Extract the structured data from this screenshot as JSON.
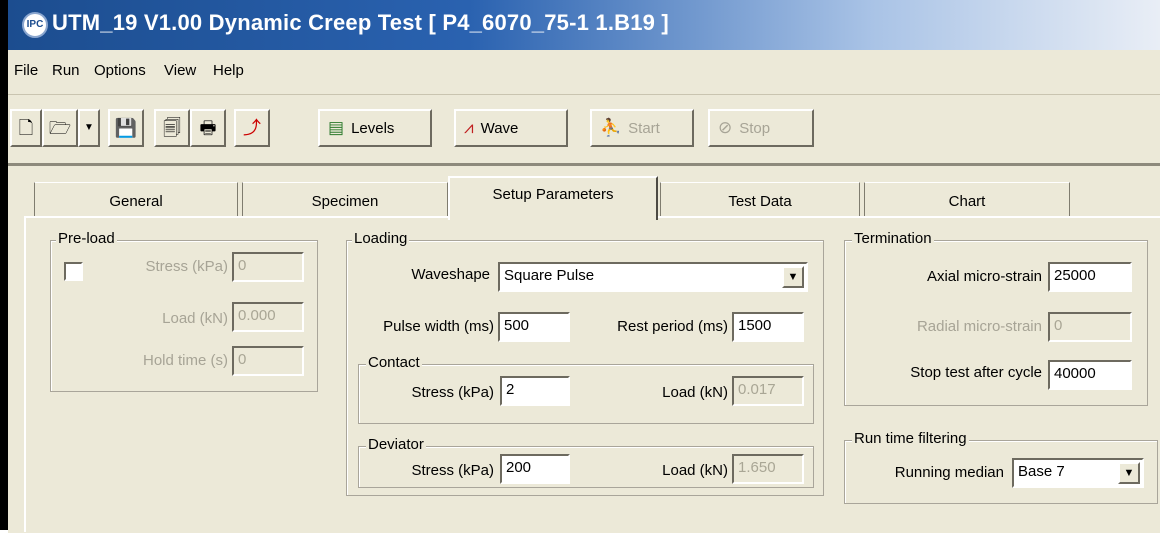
{
  "window": {
    "title": "UTM_19  V1.00 Dynamic Creep Test [ P4_6070_75-1 1.B19 ]",
    "icon_label": "IPC"
  },
  "menu": [
    "File",
    "Run",
    "Options",
    "View",
    "Help"
  ],
  "toolbar": {
    "icons": [
      "new-file-icon",
      "open-file-icon",
      "dropdown-arrow-icon",
      "save-icon",
      "print-preview-icon",
      "print-icon",
      "export-icon"
    ],
    "levels_label": "Levels",
    "wave_label": "Wave",
    "start_label": "Start",
    "stop_label": "Stop"
  },
  "tabs": [
    {
      "label": "General"
    },
    {
      "label": "Specimen"
    },
    {
      "label": "Setup Parameters"
    },
    {
      "label": "Test Data"
    },
    {
      "label": "Chart"
    }
  ],
  "preload": {
    "title": "Pre-load",
    "stress_label": "Stress (kPa)",
    "stress_value": "0",
    "load_label": "Load (kN)",
    "load_value": "0.000",
    "hold_label": "Hold time (s)",
    "hold_value": "0"
  },
  "loading": {
    "title": "Loading",
    "waveshape_label": "Waveshape",
    "waveshape_value": "Square Pulse",
    "pulse_label": "Pulse width (ms)",
    "pulse_value": "500",
    "rest_label": "Rest period (ms)",
    "rest_value": "1500"
  },
  "contact": {
    "title": "Contact",
    "stress_label": "Stress (kPa)",
    "stress_value": "2",
    "load_label": "Load (kN)",
    "load_value": "0.017"
  },
  "deviator": {
    "title": "Deviator",
    "stress_label": "Stress (kPa)",
    "stress_value": "200",
    "load_label": "Load (kN)",
    "load_value": "1.650"
  },
  "termination": {
    "title": "Termination",
    "axial_label": "Axial micro-strain",
    "axial_value": "25000",
    "radial_label": "Radial micro-strain",
    "radial_value": "0",
    "stop_label": "Stop test after cycle",
    "stop_value": "40000"
  },
  "filtering": {
    "title": "Run time filtering",
    "median_label": "Running median",
    "median_value": "Base 7"
  }
}
